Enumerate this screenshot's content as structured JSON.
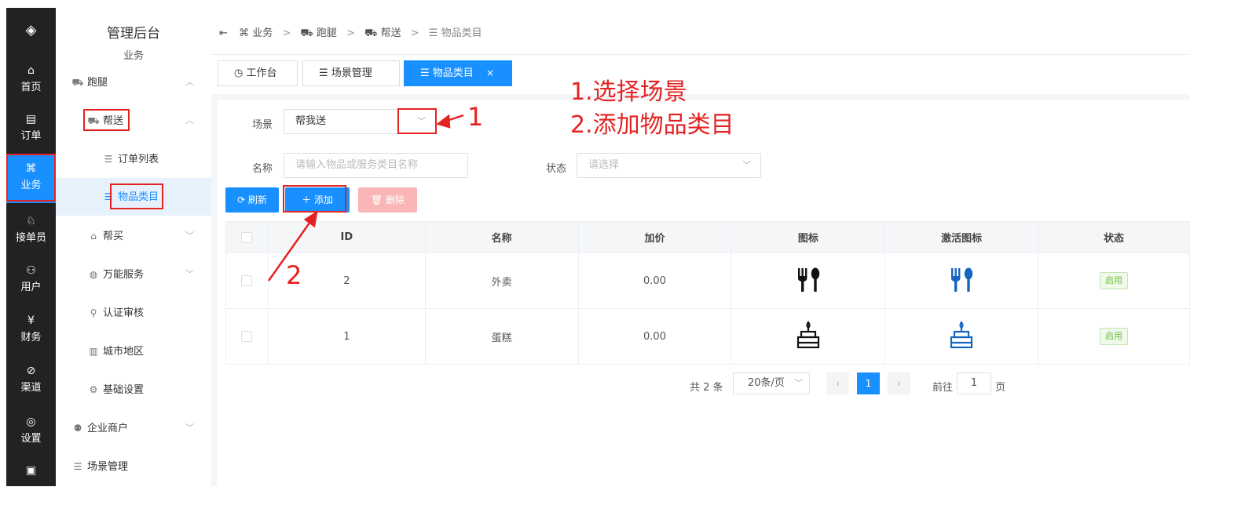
{
  "rail": {
    "items": [
      {
        "icon": "⌂",
        "label": "首页"
      },
      {
        "icon": "▤",
        "label": "订单"
      },
      {
        "icon": "⌘",
        "label": "业务"
      },
      {
        "icon": "♘",
        "label": "接单员"
      },
      {
        "icon": "⚇",
        "label": "用户"
      },
      {
        "icon": "¥",
        "label": "财务"
      },
      {
        "icon": "⊘",
        "label": "渠道"
      },
      {
        "icon": "◎",
        "label": "设置"
      },
      {
        "icon": "▣",
        "label": ""
      }
    ],
    "active_index": 2
  },
  "menu": {
    "title": "管理后台",
    "subtitle": "业务",
    "items": [
      {
        "icon": "⛟",
        "label": "跑腿",
        "arrow": "︿"
      },
      {
        "icon": "⛟",
        "label": "帮送",
        "arrow": "︿"
      },
      {
        "icon": "☰",
        "label": "订单列表"
      },
      {
        "icon": "☰",
        "label": "物品类目"
      },
      {
        "icon": "⌂",
        "label": "帮买",
        "arrow": "﹀"
      },
      {
        "icon": "◍",
        "label": "万能服务",
        "arrow": "﹀"
      },
      {
        "icon": "⚲",
        "label": "认证审核"
      },
      {
        "icon": "▥",
        "label": "城市地区"
      },
      {
        "icon": "⚙",
        "label": "基础设置"
      },
      {
        "icon": "⚉",
        "label": "企业商户",
        "arrow": "﹀"
      },
      {
        "icon": "☰",
        "label": "场景管理"
      }
    ]
  },
  "breadcrumb": {
    "toggle_icon": "⇤",
    "items": [
      {
        "icon": "⌘",
        "label": "业务"
      },
      {
        "icon": "⛟",
        "label": "跑腿"
      },
      {
        "icon": "⛟",
        "label": "帮送"
      },
      {
        "icon": "☰",
        "label": "物品类目"
      }
    ],
    "separator": ">"
  },
  "tabs": [
    {
      "icon": "◷",
      "label": "工作台"
    },
    {
      "icon": "☰",
      "label": "场景管理"
    },
    {
      "icon": "☰",
      "label": "物品类目",
      "close": "×"
    }
  ],
  "filters": {
    "scene_label": "场景",
    "scene_value": "帮我送",
    "name_label": "名称",
    "name_placeholder": "请输入物品或服务类目名称",
    "status_label": "状态",
    "status_placeholder": "请选择",
    "chevron": "﹀"
  },
  "buttons": {
    "refresh": "⟳  刷新",
    "add": "＋  添加",
    "delete": "🗑  删除"
  },
  "table": {
    "headers": [
      "",
      "ID",
      "名称",
      "加价",
      "图标",
      "激活图标",
      "状态"
    ],
    "rows": [
      {
        "id": "2",
        "name": "外卖",
        "price": "0.00",
        "status": "启用"
      },
      {
        "id": "1",
        "name": "蛋糕",
        "price": "0.00",
        "status": "启用"
      }
    ]
  },
  "pagination": {
    "total": "共 2 条",
    "page_size": "20条/页",
    "prev": "‹",
    "current": "1",
    "next": "›",
    "goto_label": "前往",
    "goto_value": "1",
    "page_suffix": "页"
  },
  "annotations": {
    "step1": "1.选择场景",
    "step2": "2.添加物品类目",
    "marker1": "1",
    "marker2": "2"
  },
  "colors": {
    "primary": "#1890ff",
    "rail_bg": "#222222",
    "annotation": "#e52222",
    "icon_dark": "#111111",
    "icon_blue": "#1565c0"
  }
}
